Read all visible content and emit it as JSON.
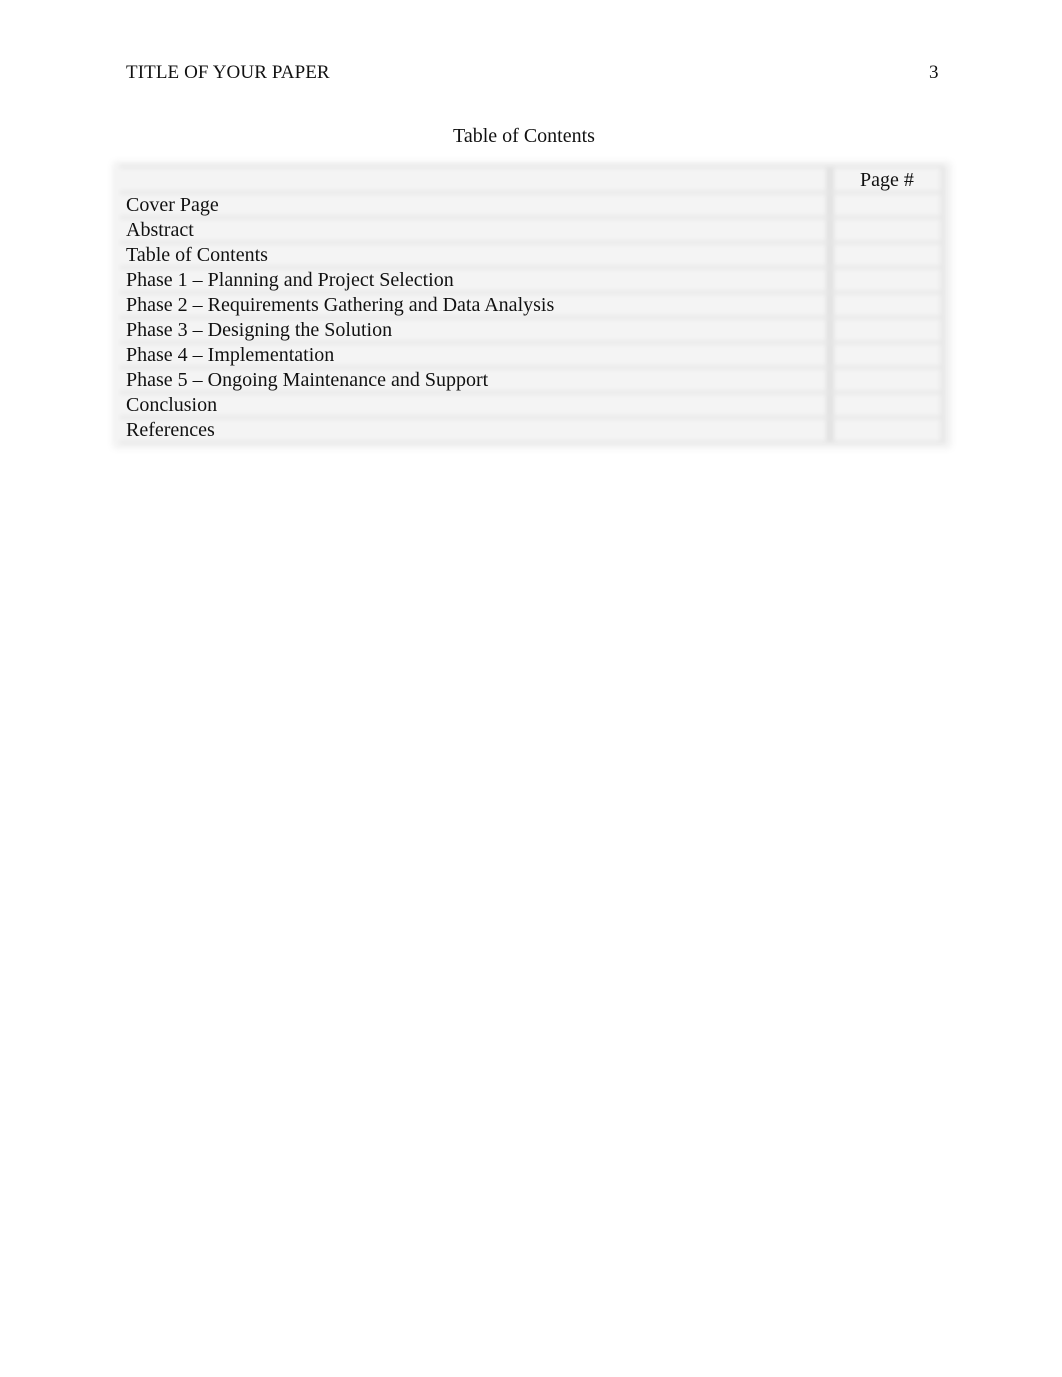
{
  "header": {
    "running_head": "TITLE OF YOUR PAPER",
    "page_number": "3"
  },
  "toc": {
    "title": "Table of Contents",
    "column_headers": {
      "entry": "",
      "page": "Page #"
    },
    "entries": [
      {
        "title": "Cover Page",
        "page": ""
      },
      {
        "title": "Abstract",
        "page": ""
      },
      {
        "title": "Table of Contents",
        "page": ""
      },
      {
        "title": "Phase 1 – Planning and Project Selection",
        "page": ""
      },
      {
        "title": "Phase 2 – Requirements Gathering and Data Analysis",
        "page": ""
      },
      {
        "title": "Phase 3 – Designing the Solution",
        "page": ""
      },
      {
        "title": "Phase 4 – Implementation",
        "page": ""
      },
      {
        "title": "Phase 5 – Ongoing Maintenance and Support",
        "page": ""
      },
      {
        "title": "Conclusion",
        "page": ""
      },
      {
        "title": "References",
        "page": ""
      }
    ]
  }
}
